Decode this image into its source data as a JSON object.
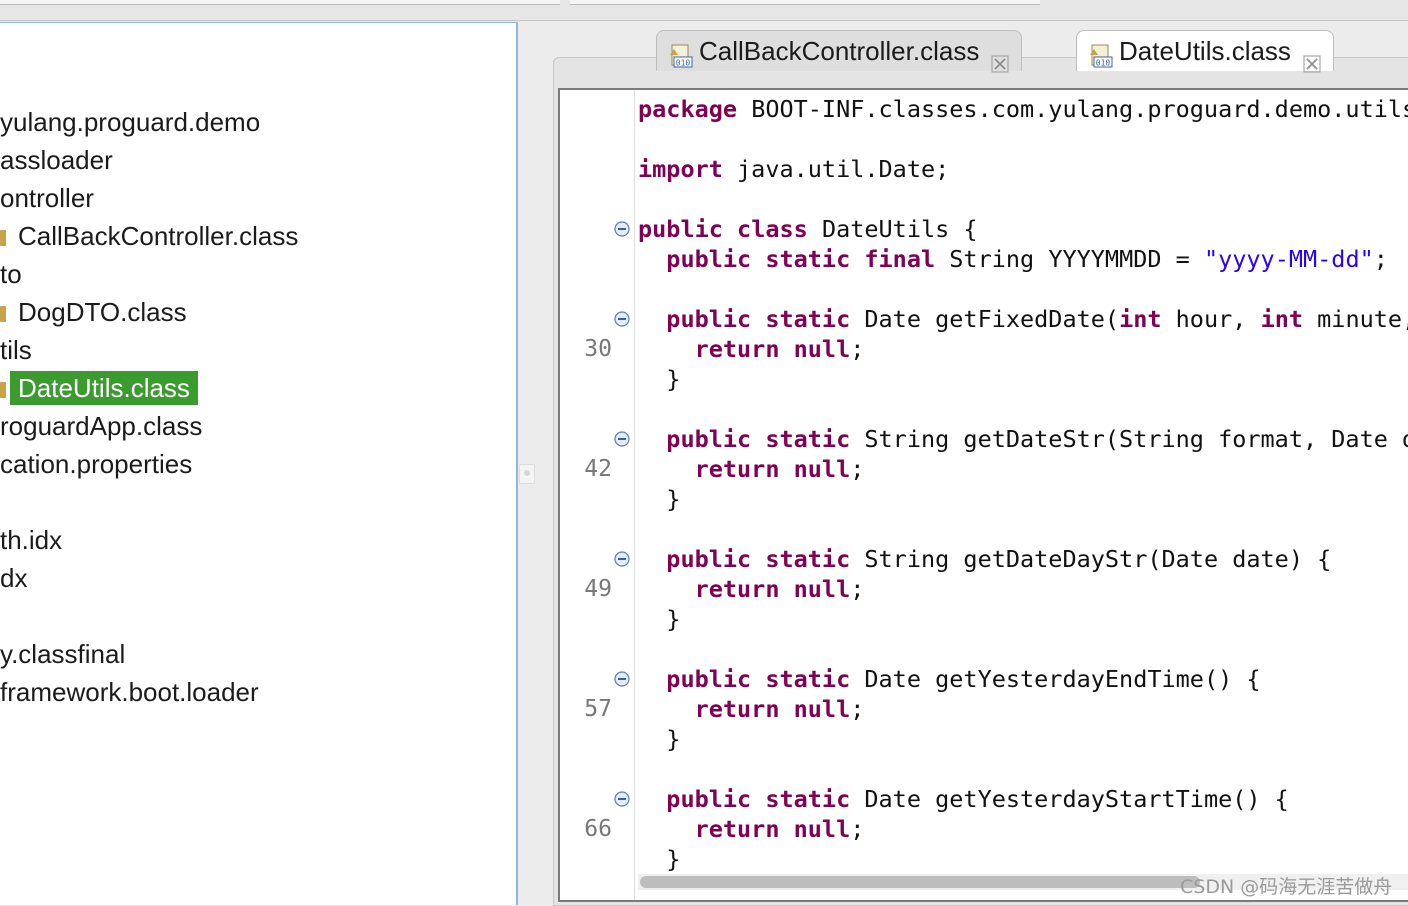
{
  "explorer": {
    "items": [
      {
        "label": "yulang.proguard.demo",
        "icon": false
      },
      {
        "label": "assloader",
        "icon": false
      },
      {
        "label": "ontroller",
        "icon": false
      },
      {
        "label": "CallBackController.class",
        "icon": true
      },
      {
        "label": "to",
        "icon": false
      },
      {
        "label": "DogDTO.class",
        "icon": true
      },
      {
        "label": "tils",
        "icon": false
      },
      {
        "label": "DateUtils.class",
        "icon": true,
        "selected": true
      },
      {
        "label": "roguardApp.class",
        "icon": false
      },
      {
        "label": "cation.properties",
        "icon": false
      },
      {
        "label": "",
        "icon": false
      },
      {
        "label": "th.idx",
        "icon": false
      },
      {
        "label": "dx",
        "icon": false
      },
      {
        "label": "",
        "icon": false
      },
      {
        "label": "y.classfinal",
        "icon": false
      },
      {
        "label": "framework.boot.loader",
        "icon": false
      }
    ]
  },
  "tabs": [
    {
      "label": "CallBackController.class",
      "active": false
    },
    {
      "label": "DateUtils.class",
      "active": true
    }
  ],
  "editor": {
    "lines": [
      {
        "ln": "",
        "fold": false,
        "segs": [
          {
            "t": "package",
            "k": true
          },
          {
            "t": " BOOT-INF.classes.com.yulang.proguard.demo.utils;"
          }
        ]
      },
      {
        "ln": "",
        "fold": false,
        "segs": []
      },
      {
        "ln": "",
        "fold": false,
        "segs": [
          {
            "t": "import",
            "k": true
          },
          {
            "t": " java.util.Date;"
          }
        ]
      },
      {
        "ln": "",
        "fold": false,
        "segs": []
      },
      {
        "ln": "",
        "fold": true,
        "segs": [
          {
            "t": "public",
            "k": true
          },
          {
            "t": " "
          },
          {
            "t": "class",
            "k": true
          },
          {
            "t": " DateUtils {"
          }
        ]
      },
      {
        "ln": "",
        "fold": false,
        "segs": [
          {
            "t": "  "
          },
          {
            "t": "public",
            "k": true
          },
          {
            "t": " "
          },
          {
            "t": "static",
            "k": true
          },
          {
            "t": " "
          },
          {
            "t": "final",
            "k": true
          },
          {
            "t": " String YYYYMMDD = "
          },
          {
            "t": "\"yyyy-MM-dd\"",
            "s": true
          },
          {
            "t": ";"
          }
        ]
      },
      {
        "ln": "",
        "fold": false,
        "segs": []
      },
      {
        "ln": "",
        "fold": true,
        "segs": [
          {
            "t": "  "
          },
          {
            "t": "public",
            "k": true
          },
          {
            "t": " "
          },
          {
            "t": "static",
            "k": true
          },
          {
            "t": " Date getFixedDate("
          },
          {
            "t": "int",
            "k": true
          },
          {
            "t": " hour, "
          },
          {
            "t": "int",
            "k": true
          },
          {
            "t": " minute, int second) {"
          }
        ]
      },
      {
        "ln": "30",
        "fold": false,
        "segs": [
          {
            "t": "    "
          },
          {
            "t": "return",
            "k": true
          },
          {
            "t": " "
          },
          {
            "t": "null",
            "k": true
          },
          {
            "t": ";"
          }
        ]
      },
      {
        "ln": "",
        "fold": false,
        "segs": [
          {
            "t": "  }"
          }
        ]
      },
      {
        "ln": "",
        "fold": false,
        "segs": []
      },
      {
        "ln": "",
        "fold": true,
        "segs": [
          {
            "t": "  "
          },
          {
            "t": "public",
            "k": true
          },
          {
            "t": " "
          },
          {
            "t": "static",
            "k": true
          },
          {
            "t": " String getDateStr(String format, Date date) {"
          }
        ]
      },
      {
        "ln": "42",
        "fold": false,
        "segs": [
          {
            "t": "    "
          },
          {
            "t": "return",
            "k": true
          },
          {
            "t": " "
          },
          {
            "t": "null",
            "k": true
          },
          {
            "t": ";"
          }
        ]
      },
      {
        "ln": "",
        "fold": false,
        "segs": [
          {
            "t": "  }"
          }
        ]
      },
      {
        "ln": "",
        "fold": false,
        "segs": []
      },
      {
        "ln": "",
        "fold": true,
        "segs": [
          {
            "t": "  "
          },
          {
            "t": "public",
            "k": true
          },
          {
            "t": " "
          },
          {
            "t": "static",
            "k": true
          },
          {
            "t": " String getDateDayStr(Date date) {"
          }
        ]
      },
      {
        "ln": "49",
        "fold": false,
        "segs": [
          {
            "t": "    "
          },
          {
            "t": "return",
            "k": true
          },
          {
            "t": " "
          },
          {
            "t": "null",
            "k": true
          },
          {
            "t": ";"
          }
        ]
      },
      {
        "ln": "",
        "fold": false,
        "segs": [
          {
            "t": "  }"
          }
        ]
      },
      {
        "ln": "",
        "fold": false,
        "segs": []
      },
      {
        "ln": "",
        "fold": true,
        "segs": [
          {
            "t": "  "
          },
          {
            "t": "public",
            "k": true
          },
          {
            "t": " "
          },
          {
            "t": "static",
            "k": true
          },
          {
            "t": " Date getYesterdayEndTime() {"
          }
        ]
      },
      {
        "ln": "57",
        "fold": false,
        "segs": [
          {
            "t": "    "
          },
          {
            "t": "return",
            "k": true
          },
          {
            "t": " "
          },
          {
            "t": "null",
            "k": true
          },
          {
            "t": ";"
          }
        ]
      },
      {
        "ln": "",
        "fold": false,
        "segs": [
          {
            "t": "  }"
          }
        ]
      },
      {
        "ln": "",
        "fold": false,
        "segs": []
      },
      {
        "ln": "",
        "fold": true,
        "segs": [
          {
            "t": "  "
          },
          {
            "t": "public",
            "k": true
          },
          {
            "t": " "
          },
          {
            "t": "static",
            "k": true
          },
          {
            "t": " Date getYesterdayStartTime() {"
          }
        ]
      },
      {
        "ln": "66",
        "fold": false,
        "segs": [
          {
            "t": "    "
          },
          {
            "t": "return",
            "k": true
          },
          {
            "t": " "
          },
          {
            "t": "null",
            "k": true
          },
          {
            "t": ";"
          }
        ]
      },
      {
        "ln": "",
        "fold": false,
        "segs": [
          {
            "t": "  }"
          }
        ]
      }
    ]
  },
  "watermark": "CSDN @码海无涯苦做舟",
  "colors": {
    "keyword": "#7f0055",
    "string": "#2a00ff",
    "selection": "#3c9b2e",
    "explorer_border": "#8fb6de"
  },
  "icons": [
    "class-file-icon",
    "close-tab-icon",
    "fold-collapse-icon"
  ]
}
